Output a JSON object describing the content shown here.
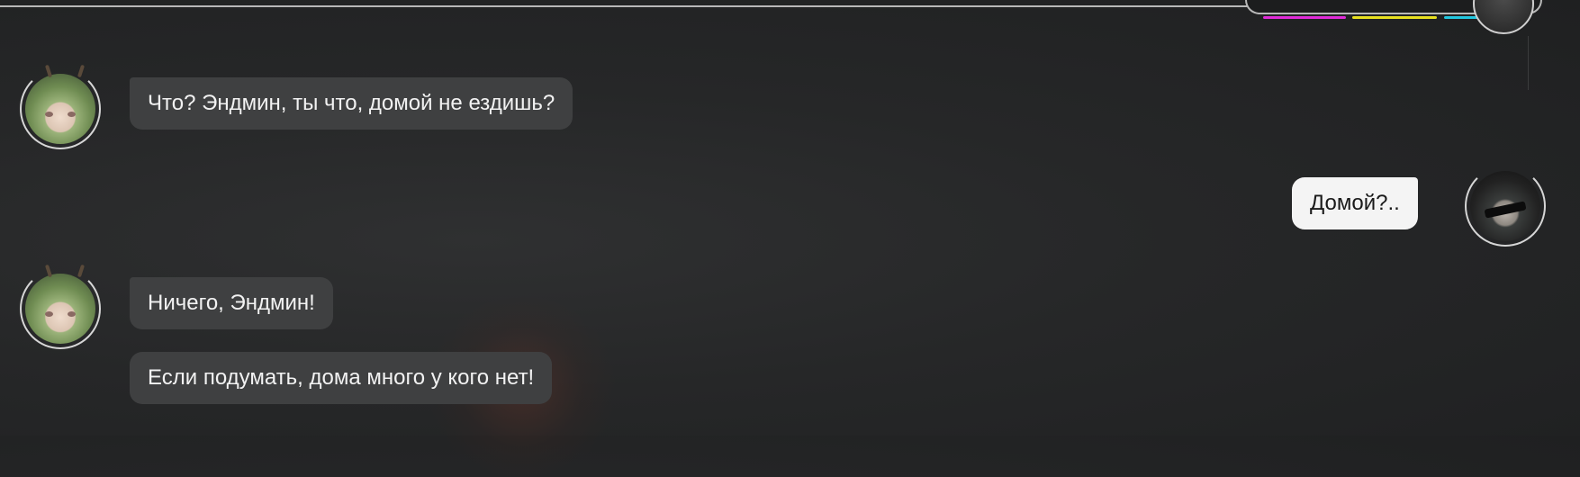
{
  "theme": {
    "accent_magenta": "#e02bd8",
    "accent_yellow": "#e8e020",
    "accent_cyan": "#22c8e0",
    "incoming_bubble": "#3f4041",
    "outgoing_bubble": "#f4f4f4"
  },
  "chat": {
    "messages": [
      {
        "side": "left",
        "avatar": "green-hair-character-avatar",
        "text": "Что? Эндмин, ты что, домой не ездишь?"
      },
      {
        "side": "right",
        "avatar": "blindfolded-character-avatar",
        "text": "Домой?.."
      },
      {
        "side": "left",
        "avatar": "green-hair-character-avatar",
        "text": "Ничего, Эндмин!"
      },
      {
        "side": "left",
        "avatar": null,
        "text": "Если подумать, дома много у кого нет!"
      }
    ]
  }
}
